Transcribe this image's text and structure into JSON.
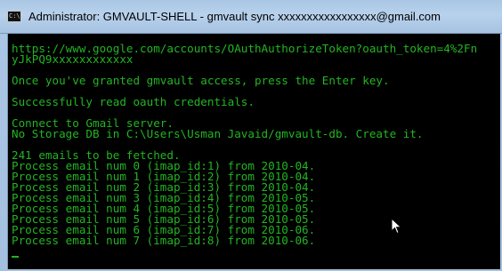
{
  "window": {
    "title_prefix": "Administrator: GMVAULT-SHELL - gmvault  sync ",
    "title_email_obscured": "xxxxxxxxxxxxxxxxx",
    "title_email_domain": "@gmail.com",
    "app_icon_glyph": "C:\\"
  },
  "console": {
    "text_color": "#23b423",
    "background": "#000000",
    "lines": [
      "https://www.google.com/accounts/OAuthAuthorizeToken?oauth_token=4%2Fn",
      "yJkPQ9xxxxxxxxxxxx",
      "",
      "Once you've granted gmvault access, press the Enter key.",
      "",
      "Successfully read oauth credentials.",
      "",
      "Connect to Gmail server.",
      "No Storage DB in C:\\Users\\Usman Javaid/gmvault-db. Create it.",
      "",
      "241 emails to be fetched.",
      "Process email num 0 (imap_id:1) from 2010-04.",
      "Process email num 1 (imap_id:2) from 2010-04.",
      "Process email num 2 (imap_id:3) from 2010-04.",
      "Process email num 3 (imap_id:4) from 2010-05.",
      "Process email num 4 (imap_id:5) from 2010-05.",
      "Process email num 5 (imap_id:6) from 2010-05.",
      "Process email num 6 (imap_id:7) from 2010-06.",
      "Process email num 7 (imap_id:8) from 2010-06."
    ]
  }
}
